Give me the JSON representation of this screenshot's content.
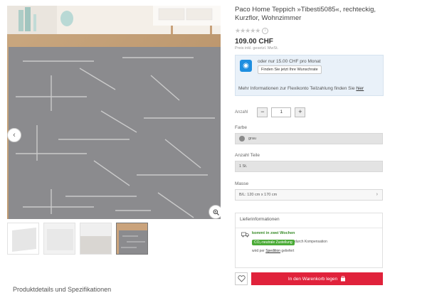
{
  "gallery": {
    "prev_arrow": "‹",
    "thumb_count": 4,
    "active_thumb": 4
  },
  "below_text": "Produktdetails und Spezifikationen",
  "product": {
    "title": "Paco Home Teppich »Tibesti5085«, rechteckig, Kurzflor, Wohnzimmer",
    "stars": "★★★★★",
    "price": "109.00 CHF",
    "price_note": "Preis inkl. gesetzl. MwSt."
  },
  "finance": {
    "text": "oder nur 15.00 CHF pro Monat",
    "button": "Finden Sie jetzt Ihre Wunschrate",
    "more_prefix": "Mehr Informationen zur Flexikonto Teilzahlung finden Sie ",
    "more_link": "hier"
  },
  "quantity": {
    "label": "Anzahl",
    "value": "1",
    "minus": "−",
    "plus": "+"
  },
  "color": {
    "label": "Farbe",
    "value": "grau"
  },
  "pieces": {
    "label": "Anzahl Teile",
    "value": "1 St."
  },
  "size": {
    "label": "Masse",
    "value": "B/L: 120 cm x 170 cm"
  },
  "delivery": {
    "heading": "Lieferinformationen",
    "time": "kommt in zwei Wochen",
    "co2_badge": "CO₂-neutrale Zustellung",
    "co2_after": "durch Kompensation",
    "via_prefix": "wird per ",
    "via_link": "Spedition",
    "via_suffix": " geliefert"
  },
  "cart": {
    "label": "In den Warenkorb legen"
  },
  "colors": {
    "cart": "#e0223b",
    "finance_bg": "#e9f1f9",
    "co2": "#4bab37"
  }
}
